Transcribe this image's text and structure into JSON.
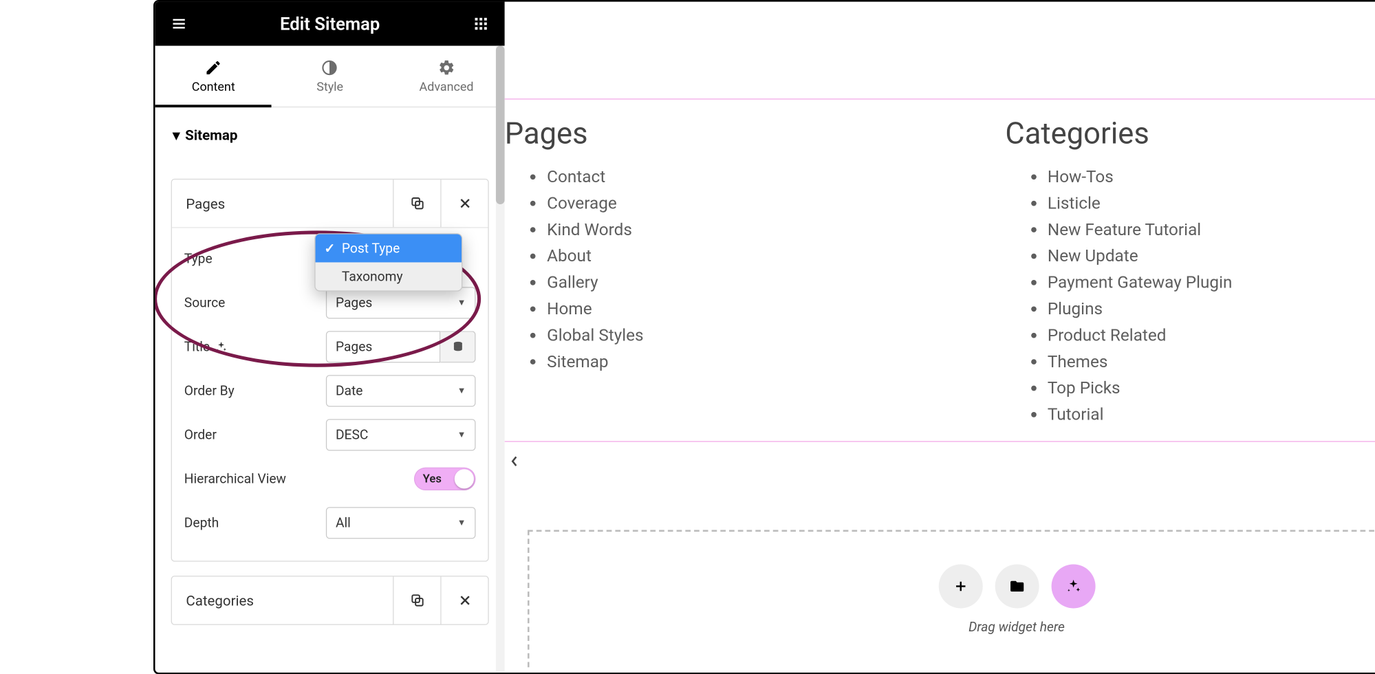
{
  "topbar": {
    "title": "Edit Sitemap"
  },
  "tabs": {
    "content": "Content",
    "style": "Style",
    "advanced": "Advanced"
  },
  "section": {
    "heading": "Sitemap"
  },
  "items": {
    "pages": {
      "title": "Pages"
    },
    "categories": {
      "title": "Categories"
    }
  },
  "fields": {
    "type": {
      "label": "Type",
      "options": {
        "post_type": "Post Type",
        "taxonomy": "Taxonomy"
      }
    },
    "source": {
      "label": "Source",
      "value": "Pages"
    },
    "title": {
      "label": "Title",
      "value": "Pages"
    },
    "order_by": {
      "label": "Order By",
      "value": "Date"
    },
    "order": {
      "label": "Order",
      "value": "DESC"
    },
    "hierarchical": {
      "label": "Hierarchical View",
      "value": "Yes"
    },
    "depth": {
      "label": "Depth",
      "value": "All"
    }
  },
  "preview": {
    "pages": {
      "heading": "Pages",
      "items": [
        "Contact",
        "Coverage",
        "Kind Words",
        "About",
        "Gallery",
        "Home",
        "Global Styles",
        "Sitemap"
      ]
    },
    "categories": {
      "heading": "Categories",
      "items": [
        "How-Tos",
        "Listicle",
        "New Feature Tutorial",
        "New Update",
        "Payment Gateway Plugin",
        "Plugins",
        "Product Related",
        "Themes",
        "Top Picks",
        "Tutorial"
      ]
    }
  },
  "dropzone": {
    "text": "Drag widget here"
  }
}
